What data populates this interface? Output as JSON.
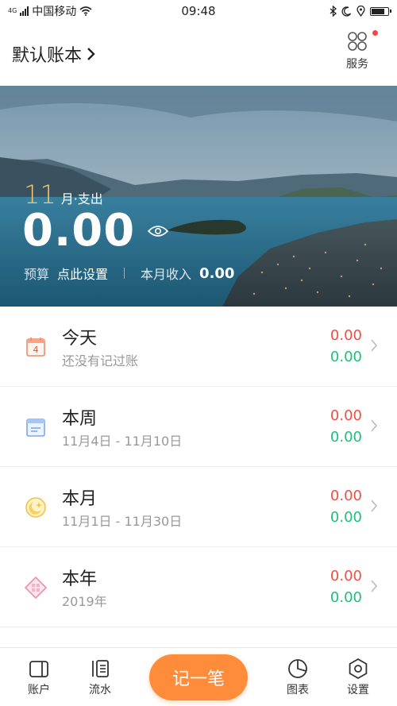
{
  "status_bar": {
    "network": "4G",
    "carrier": "中国移动",
    "time": "09:48"
  },
  "header": {
    "book_title": "默认账本",
    "service_label": "服务"
  },
  "summary": {
    "month": "11",
    "month_suffix": "月·支出",
    "expense_amount": "0.00",
    "budget_label": "预算",
    "budget_action": "点此设置",
    "income_label": "本月收入",
    "income_value": "0.00"
  },
  "periods": [
    {
      "title": "今天",
      "subtitle": "还没有记过账",
      "expense": "0.00",
      "income": "0.00",
      "icon": "calendar-day-icon",
      "calendar_day": "4"
    },
    {
      "title": "本周",
      "subtitle": "11月4日 - 11月10日",
      "expense": "0.00",
      "income": "0.00",
      "icon": "calendar-week-icon"
    },
    {
      "title": "本月",
      "subtitle": "11月1日 - 11月30日",
      "expense": "0.00",
      "income": "0.00",
      "icon": "moon-icon"
    },
    {
      "title": "本年",
      "subtitle": "2019年",
      "expense": "0.00",
      "income": "0.00",
      "icon": "year-icon"
    }
  ],
  "bottom_nav": {
    "accounts": "账户",
    "flow": "流水",
    "record": "记一笔",
    "charts": "图表",
    "settings": "设置"
  },
  "colors": {
    "expense": "#ef4f43",
    "income": "#1fbf7a",
    "accent": "#ff8c3a",
    "month_highlight": "#f6c86a"
  }
}
